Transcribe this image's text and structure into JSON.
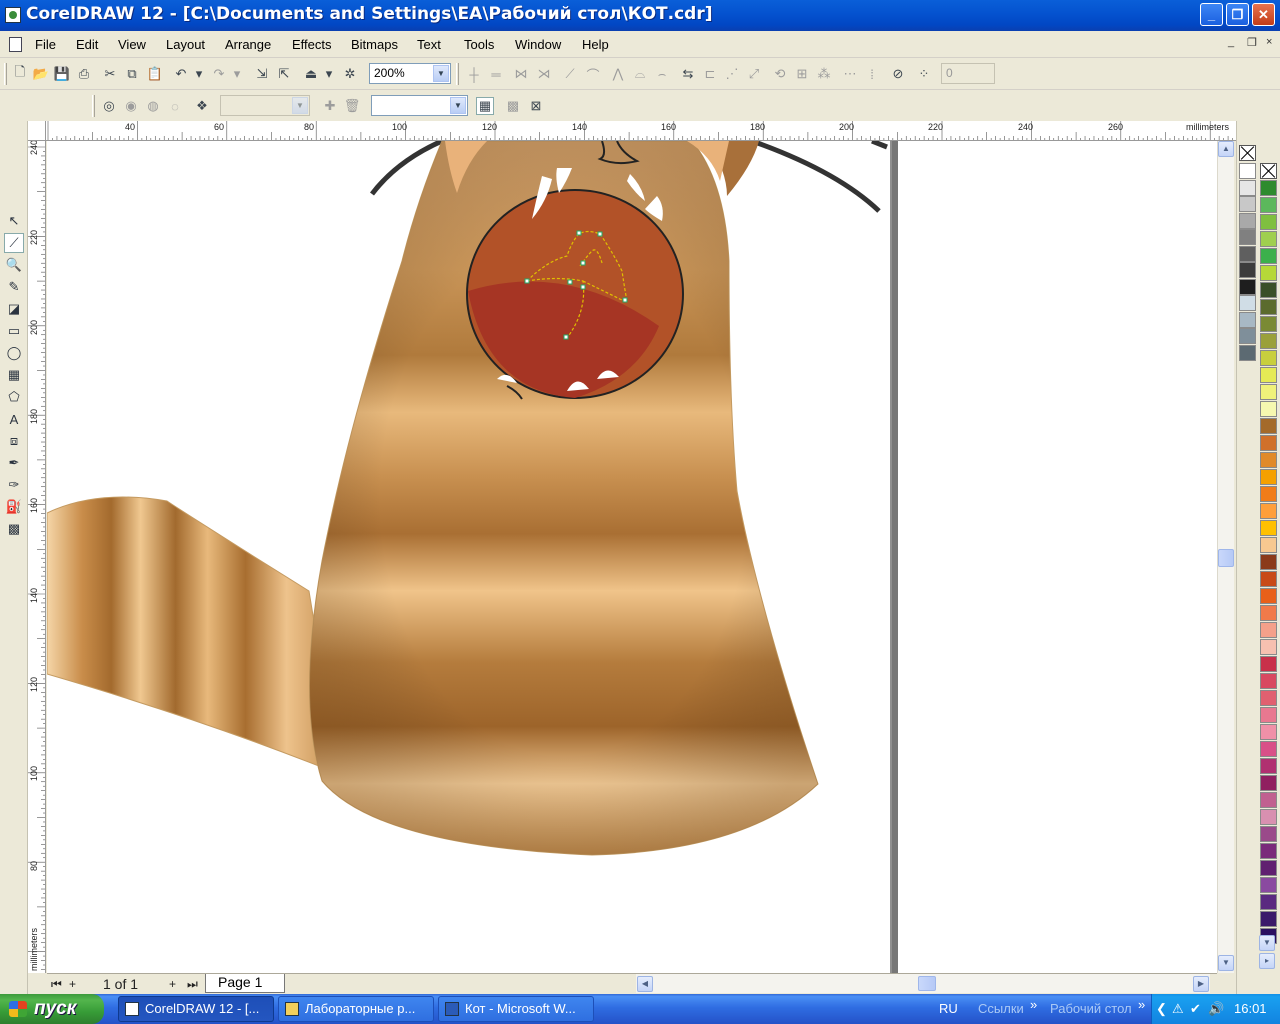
{
  "window": {
    "title": "CorelDRAW 12 - [C:\\Documents and Settings\\EA\\Рабочий стол\\КОТ.cdr]",
    "minimize_glyph": "_",
    "restore_glyph": "❐",
    "close_glyph": "✕"
  },
  "menubar": {
    "items": [
      "File",
      "Edit",
      "View",
      "Layout",
      "Arrange",
      "Effects",
      "Bitmaps",
      "Text",
      "Tools",
      "Window",
      "Help"
    ],
    "doc_controls": [
      "_",
      "❐",
      "×"
    ]
  },
  "standard_toolbar": {
    "zoom_value": "200%",
    "nudge_value": "0"
  },
  "property_bar": {
    "combo1_value": "",
    "combo2_value": ""
  },
  "rulers": {
    "unit": "millimeters",
    "horizontal_ticks": [
      "40",
      "60",
      "80",
      "100",
      "120",
      "140",
      "160",
      "180",
      "200",
      "220",
      "240",
      "260"
    ],
    "vertical_ticks": [
      "240",
      "220",
      "200",
      "180",
      "160",
      "140",
      "120",
      "100",
      "80"
    ]
  },
  "page_navigator": {
    "counter": "1 of 1",
    "page_tab": "Page 1"
  },
  "icons": {
    "toolbox": [
      "pick-tool-icon",
      "shape-tool-icon",
      "zoom-tool-icon",
      "freehand-tool-icon",
      "smart-fill-icon",
      "rectangle-tool-icon",
      "ellipse-tool-icon",
      "graph-paper-icon",
      "basic-shapes-icon",
      "text-tool-icon",
      "interactive-blend-icon",
      "eyedropper-icon",
      "outline-tool-icon",
      "fill-tool-icon",
      "interactive-fill-icon"
    ]
  },
  "palette": {
    "column1": [
      "#ffffff",
      "#e6e6e6",
      "#c8c8c8",
      "#a9a9a9",
      "#808080",
      "#5f5f5f",
      "#3c3c3c",
      "#1e1e1e",
      "#d0dde6",
      "#a8b8c4",
      "#7f8f9a",
      "#5c6a72"
    ],
    "column2": [
      "#2e8b2e",
      "#5cb85c",
      "#7fbf3f",
      "#9fcf4f",
      "#3cb04c",
      "#b6d838",
      "#3a4f28",
      "#5b6b2d",
      "#7a8a34",
      "#9aa03a",
      "#c8cf3d",
      "#e5ea55",
      "#f0f27a",
      "#f6f8b0",
      "#a46a2a",
      "#d0702a",
      "#e08a2a",
      "#f5a000",
      "#f07c18",
      "#ff9f3a",
      "#ffc000",
      "#f7c890",
      "#8b3a1a",
      "#c84a18",
      "#e8601a",
      "#f07a4a",
      "#f4a08a",
      "#f6c0b0",
      "#c8304a",
      "#d84860",
      "#e06070",
      "#e87890",
      "#f090a8",
      "#d85088",
      "#b03070",
      "#902060",
      "#c06090",
      "#d890b0",
      "#9a4a8a",
      "#7a2a7a",
      "#602070",
      "#8a4aa0",
      "#5a2a80",
      "#3a1a6a",
      "#2a1060"
    ]
  },
  "taskbar": {
    "start_label": "пуск",
    "buttons": [
      "CorelDRAW 12 - [...",
      "Лабораторные р...",
      "Кот - Microsoft W..."
    ],
    "lang": "RU",
    "links_label": "Ссылки",
    "desktop_label": "Рабочий стол",
    "chevron": "»",
    "clock": "16:01"
  }
}
